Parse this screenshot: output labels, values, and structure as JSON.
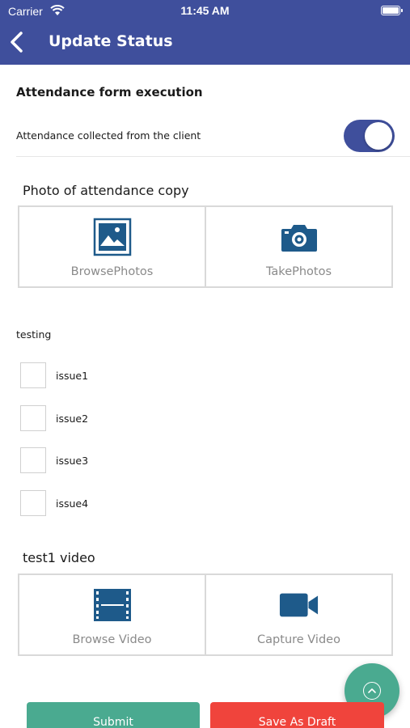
{
  "status_bar": {
    "carrier": "Carrier",
    "time": "11:45 AM"
  },
  "header": {
    "title": "Update Status"
  },
  "form": {
    "section_title": "Attendance form execution",
    "toggle_label": "Attendance collected from the client",
    "toggle_on": true
  },
  "photo_group": {
    "title": "Photo of attendance copy",
    "browse_label": "BrowsePhotos",
    "take_label": "TakePhotos"
  },
  "checklist": {
    "title": "testing",
    "items": [
      {
        "label": "issue1",
        "checked": false
      },
      {
        "label": "issue2",
        "checked": false
      },
      {
        "label": "issue3",
        "checked": false
      },
      {
        "label": "issue4",
        "checked": false
      }
    ]
  },
  "video_group": {
    "title": "test1 video",
    "browse_label": "Browse Video",
    "capture_label": "Capture Video"
  },
  "buttons": {
    "submit": "Submit",
    "draft": "Save As Draft"
  },
  "colors": {
    "primary": "#3f4f9c",
    "icon": "#1e5a8a",
    "submit": "#4aaa90",
    "draft": "#f0443c",
    "fab": "#4aaa90"
  }
}
